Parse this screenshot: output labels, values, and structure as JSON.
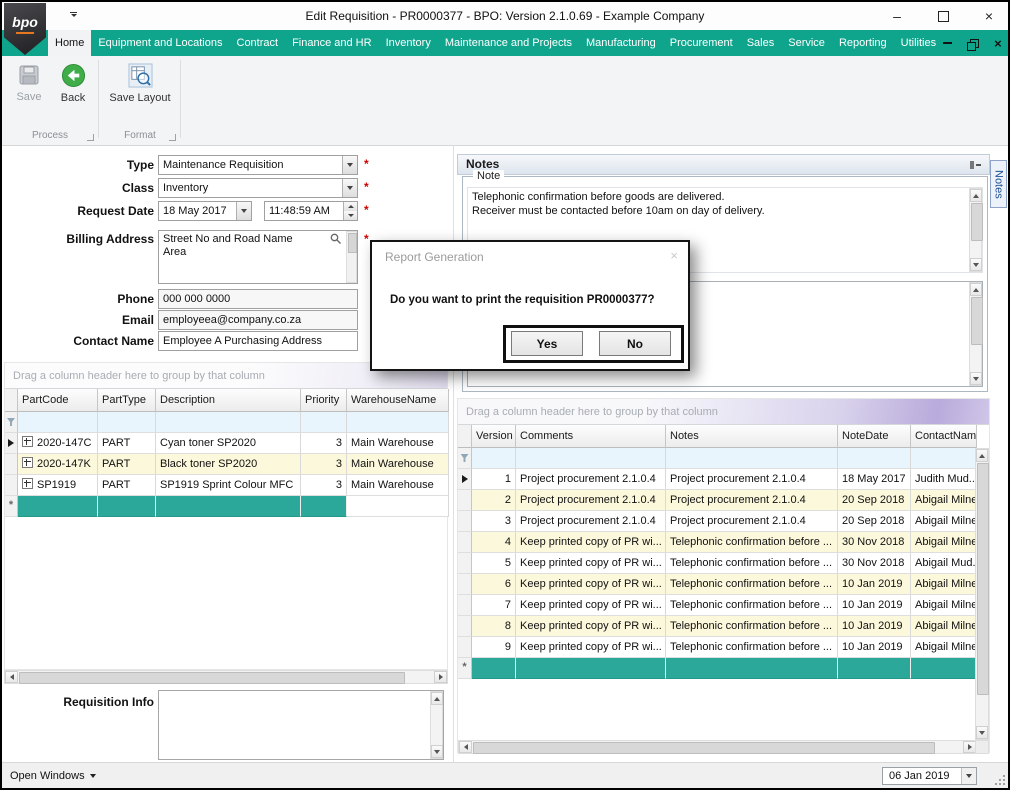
{
  "window": {
    "title": "Edit Requisition - PR0000377 - BPO: Version 2.1.0.69 - Example Company",
    "logo_text": "bpo"
  },
  "ribbon": {
    "tabs": [
      "Home",
      "Equipment and Locations",
      "Contract",
      "Finance and HR",
      "Inventory",
      "Maintenance and Projects",
      "Manufacturing",
      "Procurement",
      "Sales",
      "Service",
      "Reporting",
      "Utilities"
    ],
    "selected_tab": "Home",
    "buttons": {
      "save": "Save",
      "back": "Back",
      "save_layout": "Save Layout"
    },
    "groups": {
      "process": "Process",
      "format": "Format"
    }
  },
  "form": {
    "required_marker": "*",
    "type": {
      "label": "Type",
      "value": "Maintenance Requisition"
    },
    "class": {
      "label": "Class",
      "value": "Inventory"
    },
    "request_date": {
      "label": "Request Date",
      "date": "18 May 2017",
      "time": "11:48:59 AM"
    },
    "billing_address": {
      "label": "Billing Address",
      "line1": "Street No and Road Name",
      "line2": "Area"
    },
    "phone": {
      "label": "Phone",
      "value": "000 000 0000"
    },
    "email": {
      "label": "Email",
      "value": "employeea@company.co.za"
    },
    "contact_name": {
      "label": "Contact Name",
      "value": "Employee A Purchasing Address"
    },
    "requisition_info": {
      "label": "Requisition Info",
      "value": ""
    }
  },
  "parts_grid": {
    "group_hint": "Drag a column header here to group by that column",
    "new_row_marker": "*",
    "columns": [
      "PartCode",
      "PartType",
      "Description",
      "Priority",
      "WarehouseName"
    ],
    "rows": [
      {
        "PartCode": "2020-147C",
        "PartType": "PART",
        "Description": "Cyan toner SP2020",
        "Priority": "3",
        "WarehouseName": "Main Warehouse"
      },
      {
        "PartCode": "2020-147K",
        "PartType": "PART",
        "Description": "Black toner SP2020",
        "Priority": "3",
        "WarehouseName": "Main Warehouse"
      },
      {
        "PartCode": "SP1919",
        "PartType": "PART",
        "Description": "SP1919 Sprint Colour MFC",
        "Priority": "3",
        "WarehouseName": "Main Warehouse"
      }
    ]
  },
  "notes_panel": {
    "title": "Notes",
    "group_label": "Note",
    "note_text": "Telephonic confirmation before goods are delivered.\nReceiver must be contacted before 10am on day of delivery."
  },
  "notes_grid": {
    "group_hint": "Drag a column header here to group by that column",
    "new_row_marker": "*",
    "columns": [
      "Version",
      "Comments",
      "Notes",
      "NoteDate",
      "ContactName"
    ],
    "rows": [
      {
        "Version": "1",
        "Comments": "Project procurement 2.1.0.4",
        "Notes": "Project procurement 2.1.0.4",
        "NoteDate": "18 May 2017",
        "ContactName": "Judith Mud..."
      },
      {
        "Version": "2",
        "Comments": "Project procurement 2.1.0.4",
        "Notes": "Project procurement 2.1.0.4",
        "NoteDate": "20 Sep 2018",
        "ContactName": "Abigail Milne"
      },
      {
        "Version": "3",
        "Comments": "Project procurement 2.1.0.4",
        "Notes": "Project procurement 2.1.0.4",
        "NoteDate": "20 Sep 2018",
        "ContactName": "Abigail Milne"
      },
      {
        "Version": "4",
        "Comments": "Keep printed copy of PR wi...",
        "Notes": "Telephonic confirmation before ...",
        "NoteDate": "30 Nov 2018",
        "ContactName": "Abigail Milne"
      },
      {
        "Version": "5",
        "Comments": "Keep printed copy of PR wi...",
        "Notes": "Telephonic confirmation before ...",
        "NoteDate": "30 Nov 2018",
        "ContactName": "Abigail Mud..."
      },
      {
        "Version": "6",
        "Comments": "Keep printed copy of PR wi...",
        "Notes": "Telephonic confirmation before ...",
        "NoteDate": "10 Jan 2019",
        "ContactName": "Abigail Milne"
      },
      {
        "Version": "7",
        "Comments": "Keep printed copy of PR wi...",
        "Notes": "Telephonic confirmation before ...",
        "NoteDate": "10 Jan 2019",
        "ContactName": "Abigail Milne"
      },
      {
        "Version": "8",
        "Comments": "Keep printed copy of PR wi...",
        "Notes": "Telephonic confirmation before ...",
        "NoteDate": "10 Jan 2019",
        "ContactName": "Abigail Milne"
      },
      {
        "Version": "9",
        "Comments": "Keep printed copy of PR wi...",
        "Notes": "Telephonic confirmation before ...",
        "NoteDate": "10 Jan 2019",
        "ContactName": "Abigail Milne"
      }
    ]
  },
  "dialog": {
    "title": "Report Generation",
    "message": "Do you want to print the requisition PR0000377?",
    "yes": "Yes",
    "no": "No"
  },
  "status_bar": {
    "open_windows": "Open Windows",
    "date": "06 Jan 2019"
  },
  "side_tab": {
    "label": "Notes"
  },
  "colors": {
    "accent_teal": "#0fa58c",
    "new_row_teal": "#2ca89a",
    "alt_row_cream": "#fcf8dc",
    "filter_row_blue": "#e9f5fd",
    "required_red": "#d00000",
    "logo_accent_orange": "#e87722"
  },
  "icons": {
    "save-icon": "floppy-disk",
    "back-icon": "green-circle-left-arrow",
    "save-layout-icon": "grid-magnifier",
    "search-icon": "magnifier",
    "pin-icon": "pushpin",
    "filter-icon": "funnel",
    "dropdown-icon": "▼",
    "expand-icon": "⊞",
    "current-row-arrow-icon": "▶",
    "new-row-icon": "*",
    "minimize-icon": "–",
    "maximize-icon": "□",
    "close-icon": "×",
    "resize-grip-icon": "◢"
  }
}
